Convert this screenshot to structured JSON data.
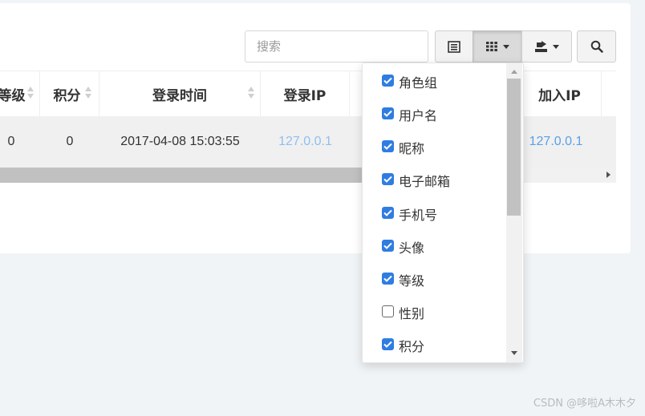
{
  "toolbar": {
    "search_placeholder": "搜索",
    "icons": [
      "list-view-icon",
      "columns-grid-icon",
      "export-icon",
      "search-icon"
    ]
  },
  "table": {
    "headers": [
      "等级",
      "积分",
      "登录时间",
      "登录IP",
      "",
      "加入IP"
    ],
    "row": {
      "level": "0",
      "score": "0",
      "login_time": "2017-04-08 15:03:55",
      "login_ip": "127.0.0.1",
      "join_ip": "127.0.0.1"
    }
  },
  "columns_menu": {
    "items": [
      {
        "label": "角色组",
        "checked": true
      },
      {
        "label": "用户名",
        "checked": true
      },
      {
        "label": "昵称",
        "checked": true
      },
      {
        "label": "电子邮箱",
        "checked": true
      },
      {
        "label": "手机号",
        "checked": true
      },
      {
        "label": "头像",
        "checked": true
      },
      {
        "label": "等级",
        "checked": true
      },
      {
        "label": "性别",
        "checked": false
      },
      {
        "label": "积分",
        "checked": true
      }
    ]
  },
  "watermark": "CSDN @哆啦A木木夕",
  "colors": {
    "link": "#5aa0e6",
    "checkbox": "#2f7de1",
    "background": "#f1f4f6"
  }
}
